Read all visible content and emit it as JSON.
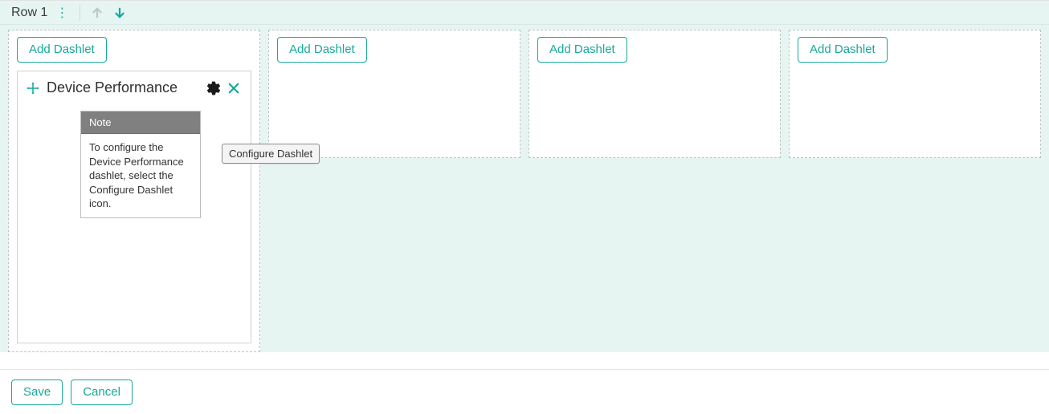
{
  "row": {
    "label": "Row 1"
  },
  "buttons": {
    "add_dashlet": "Add Dashlet",
    "save": "Save",
    "cancel": "Cancel"
  },
  "dashlet": {
    "title": "Device Performance",
    "tooltip": "Configure Dashlet",
    "note": {
      "heading": "Note",
      "body": "To configure the Device Performance dashlet, select the Configure Dashlet icon."
    }
  }
}
